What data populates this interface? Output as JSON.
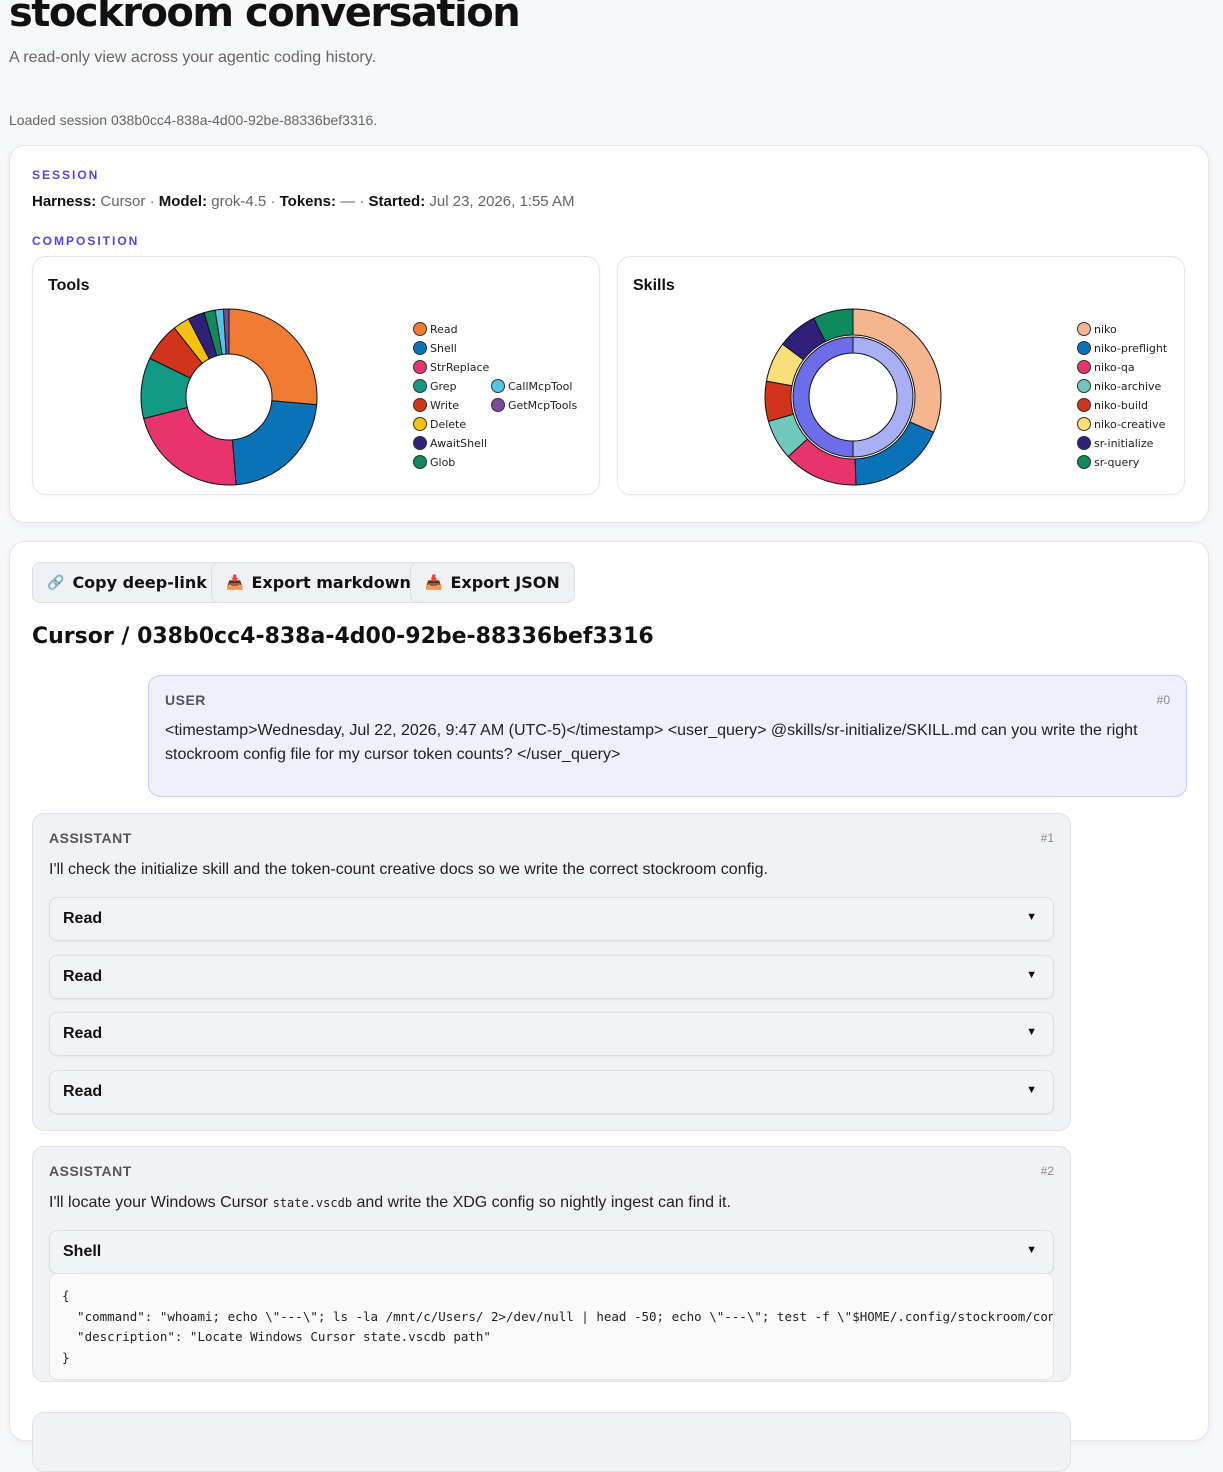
{
  "header": {
    "title": "stockroom conversation",
    "subtitle": "A read-only view across your agentic coding history.",
    "status": "Loaded session 038b0cc4-838a-4d00-92be-88336bef3316."
  },
  "session": {
    "section_label": "SESSION",
    "harness_label": "Harness:",
    "harness": "Cursor",
    "model_label": "Model:",
    "model": "grok-4.5",
    "tokens_label": "Tokens:",
    "tokens": "—",
    "started_label": "Started:",
    "started": "Jul 23, 2026, 1:55 AM",
    "sep": "·"
  },
  "composition": {
    "section_label": "COMPOSITION"
  },
  "chart_data": [
    {
      "type": "pie",
      "title": "Tools",
      "categories": [
        "Read",
        "Shell",
        "StrReplace",
        "Grep",
        "Write",
        "Delete",
        "AwaitShell",
        "Glob",
        "CallMcpTool",
        "GetMcpTools"
      ],
      "values": [
        26,
        22,
        22,
        11,
        7,
        3,
        3,
        2,
        1.5,
        1
      ],
      "colors": [
        "#f07c34",
        "#0b72b8",
        "#e8346d",
        "#129a86",
        "#d0341a",
        "#f4c20d",
        "#30207a",
        "#0f8a5c",
        "#53c3ea",
        "#7b4b98"
      ]
    },
    {
      "type": "pie",
      "title": "Skills",
      "categories": [
        "niko",
        "niko-preflight",
        "niko-qa",
        "niko-archive",
        "niko-build",
        "niko-creative",
        "sr-initialize",
        "sr-query"
      ],
      "values": [
        30,
        17,
        13,
        7,
        7,
        7,
        7,
        7
      ],
      "colors": [
        "#f5b58e",
        "#0b72b8",
        "#e8346d",
        "#70c8bd",
        "#d0341a",
        "#f8df78",
        "#30207a",
        "#0f8a5c"
      ],
      "inner_ring": {
        "values": [
          50,
          50
        ],
        "colors": [
          "#aaaef5",
          "#6b6ee8"
        ]
      }
    }
  ],
  "toolbar": {
    "copy_label": "Copy deep-link",
    "export_md_label": "Export markdown",
    "export_json_label": "Export JSON",
    "copy_icon": "🔗",
    "export_icon": "📥"
  },
  "conversation": {
    "title": "Cursor / 038b0cc4-838a-4d00-92be-88336bef3316",
    "messages": [
      {
        "role": "USER",
        "index": "#0",
        "text": "<timestamp>Wednesday, Jul 22, 2026, 9:47 AM (UTC-5)</timestamp> <user_query> @skills/sr-initialize/SKILL.md can you write the right stockroom config file for my cursor token counts? </user_query>"
      },
      {
        "role": "ASSISTANT",
        "index": "#1",
        "text": "I'll check the initialize skill and the token-count creative docs so we write the correct stockroom config.",
        "tools": [
          "Read",
          "Read",
          "Read",
          "Read"
        ]
      },
      {
        "role": "ASSISTANT",
        "index": "#2",
        "text_before": "I'll locate your Windows Cursor ",
        "text_code": "state.vscdb",
        "text_after": " and write the XDG config so nightly ingest can find it.",
        "tool": "Shell",
        "tool_body": "{\n  \"command\": \"whoami; echo \\\"---\\\"; ls -la /mnt/c/Users/ 2>/dev/null | head -50; echo \\\"---\\\"; test -f \\\"$HOME/.config/stockroom/config.json\\\"\",\n  \"description\": \"Locate Windows Cursor state.vscdb path\"\n}"
      }
    ]
  },
  "icons": {
    "chevron": "▼"
  }
}
